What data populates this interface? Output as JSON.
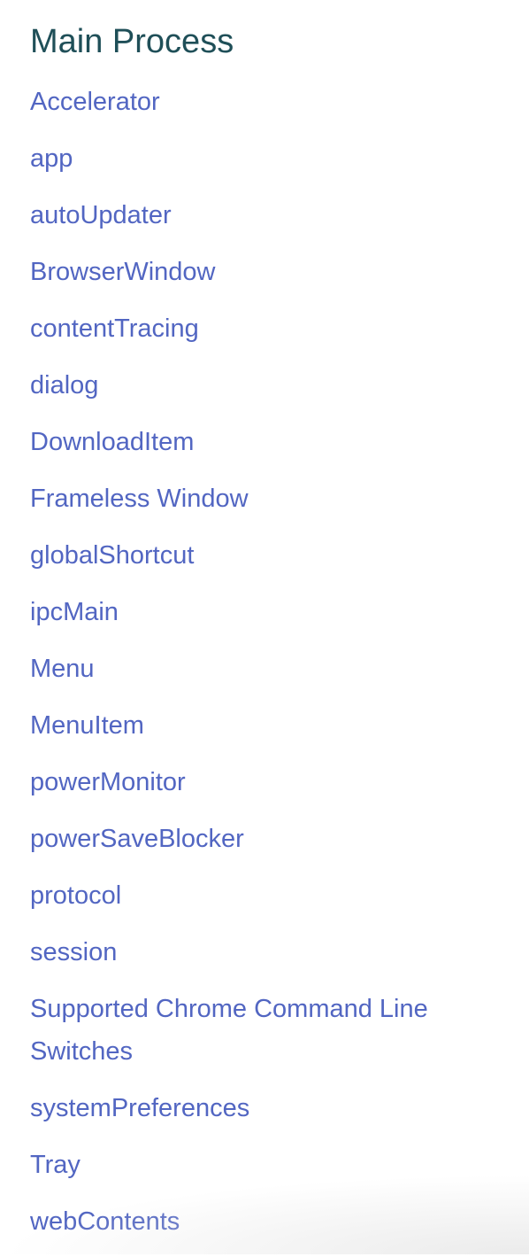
{
  "section": {
    "title": "Main Process",
    "items": [
      {
        "label": "Accelerator"
      },
      {
        "label": "app"
      },
      {
        "label": "autoUpdater"
      },
      {
        "label": "BrowserWindow"
      },
      {
        "label": "contentTracing"
      },
      {
        "label": "dialog"
      },
      {
        "label": "DownloadItem"
      },
      {
        "label": "Frameless Window"
      },
      {
        "label": "globalShortcut"
      },
      {
        "label": "ipcMain"
      },
      {
        "label": "Menu"
      },
      {
        "label": "MenuItem"
      },
      {
        "label": "powerMonitor"
      },
      {
        "label": "powerSaveBlocker"
      },
      {
        "label": "protocol"
      },
      {
        "label": "session"
      },
      {
        "label": "Supported Chrome Command Line Switches"
      },
      {
        "label": "systemPreferences"
      },
      {
        "label": "Tray"
      },
      {
        "label": "webContents"
      }
    ]
  },
  "colors": {
    "heading": "#1f4f58",
    "link": "#5266c2"
  }
}
